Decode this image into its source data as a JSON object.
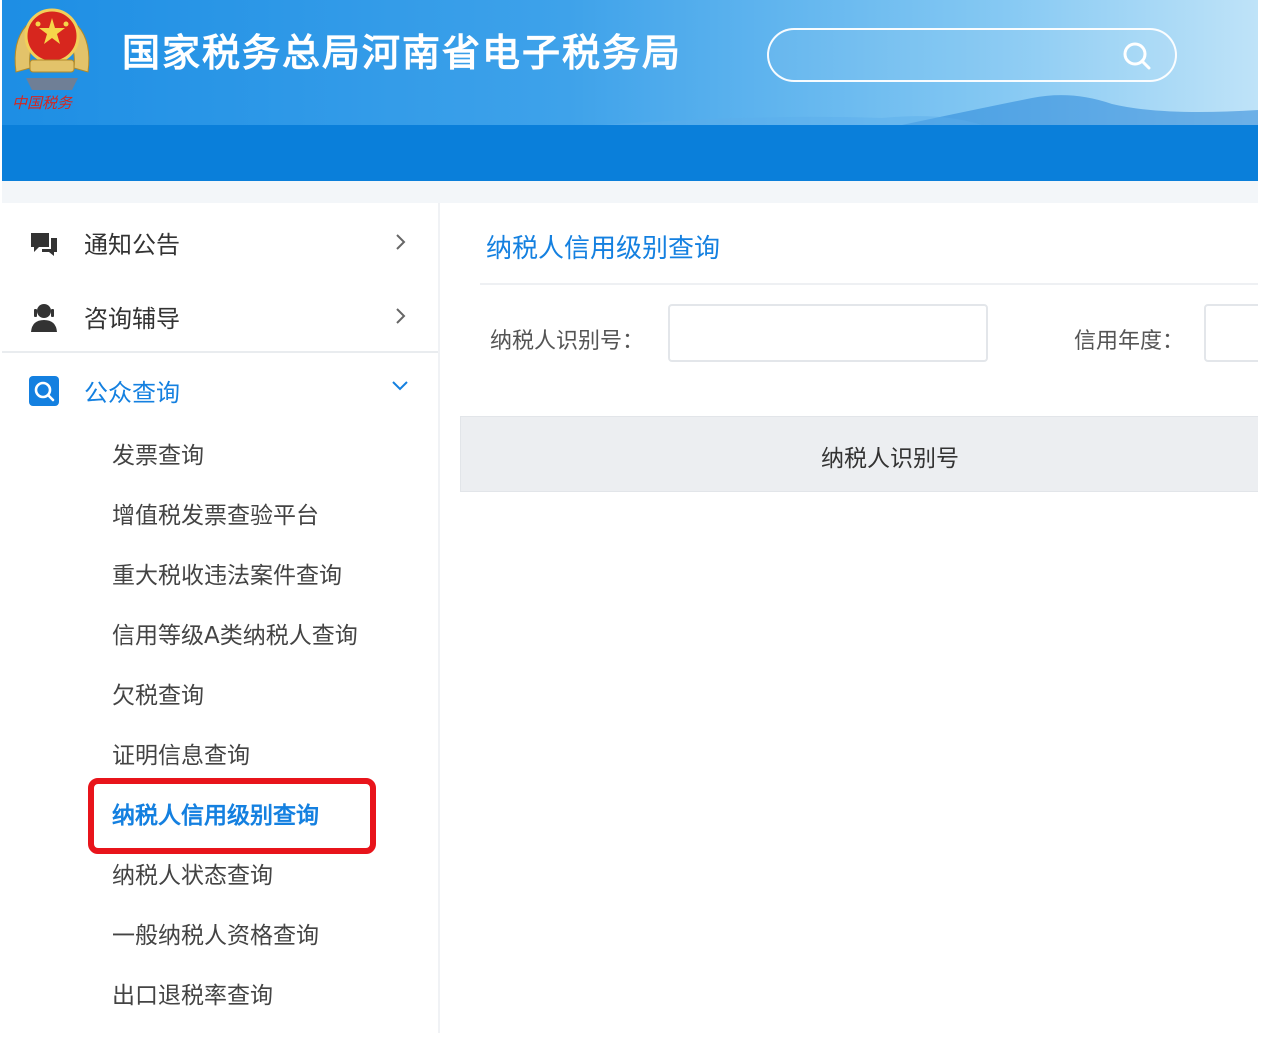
{
  "header": {
    "emblem_caption": "中国税务",
    "site_title": "国家税务总局河南省电子税务局",
    "search": {
      "placeholder": "",
      "icon": "search-icon"
    }
  },
  "sidebar": {
    "menu": [
      {
        "label": "通知公告",
        "icon": "notice-chat-icon",
        "arrow": "chevron-right-icon"
      },
      {
        "label": "咨询辅导",
        "icon": "consult-user-icon",
        "arrow": "chevron-right-icon"
      },
      {
        "label": "公众查询",
        "icon": "query-search-icon",
        "arrow": "chevron-down-icon",
        "expanded": true
      }
    ],
    "sub_items": [
      "发票查询",
      "增值税发票查验平台",
      "重大税收违法案件查询",
      "信用等级A类纳税人查询",
      "欠税查询",
      "证明信息查询",
      "纳税人信用级别查询",
      "纳税人状态查询",
      "一般纳税人资格查询",
      "出口退税率查询"
    ],
    "selected_index": 6
  },
  "main": {
    "page_title": "纳税人信用级别查询",
    "form": {
      "taxpayer_id_label": "纳税人识别号：",
      "taxpayer_id_value": "",
      "credit_year_label": "信用年度：",
      "credit_year_value": ""
    },
    "table": {
      "columns": [
        "纳税人识别号"
      ]
    }
  },
  "colors": {
    "brand_blue": "#0a7fda",
    "link_blue": "#1480e0",
    "highlight_red": "#e8141b"
  }
}
